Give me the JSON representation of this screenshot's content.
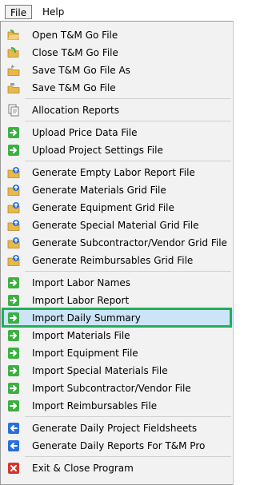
{
  "menubar": {
    "file": "File",
    "help": "Help"
  },
  "menu": {
    "groups": [
      {
        "items": [
          {
            "label": "Open T&M Go File",
            "icon": "folder-open-icon"
          },
          {
            "label": "Close T&M Go File",
            "icon": "folder-close-icon"
          },
          {
            "label": "Save T&M Go File As",
            "icon": "folder-save-as-icon"
          },
          {
            "label": "Save T&M Go File",
            "icon": "folder-save-icon"
          }
        ]
      },
      {
        "items": [
          {
            "label": "Allocation Reports",
            "icon": "document-copy-icon"
          }
        ]
      },
      {
        "items": [
          {
            "label": "Upload Price Data File",
            "icon": "green-arrow-right-icon"
          },
          {
            "label": "Upload Project Settings File",
            "icon": "green-arrow-right-icon"
          }
        ]
      },
      {
        "items": [
          {
            "label": "Generate Empty Labor Report File",
            "icon": "folder-upload-icon"
          },
          {
            "label": "Generate Materials Grid File",
            "icon": "folder-upload-icon"
          },
          {
            "label": "Generate Equipment Grid File",
            "icon": "folder-upload-icon"
          },
          {
            "label": "Generate Special Material Grid File",
            "icon": "folder-upload-icon"
          },
          {
            "label": "Generate Subcontractor/Vendor Grid File",
            "icon": "folder-upload-icon"
          },
          {
            "label": "Generate Reimbursables Grid File",
            "icon": "folder-upload-icon"
          }
        ]
      },
      {
        "items": [
          {
            "label": "Import Labor Names",
            "icon": "green-arrow-right-icon"
          },
          {
            "label": "Import Labor Report",
            "icon": "green-arrow-right-icon"
          },
          {
            "label": "Import Daily Summary",
            "icon": "green-arrow-right-icon",
            "highlighted": true
          },
          {
            "label": "Import Materials File",
            "icon": "green-arrow-right-icon"
          },
          {
            "label": "Import Equipment File",
            "icon": "green-arrow-right-icon"
          },
          {
            "label": "Import Special Materials File",
            "icon": "green-arrow-right-icon"
          },
          {
            "label": "Import Subcontractor/Vendor File",
            "icon": "green-arrow-right-icon"
          },
          {
            "label": "Import Reimbursables File",
            "icon": "green-arrow-right-icon"
          }
        ]
      },
      {
        "items": [
          {
            "label": "Generate Daily Project Fieldsheets",
            "icon": "blue-arrow-left-icon"
          },
          {
            "label": "Generate Daily Reports For T&M Pro",
            "icon": "blue-arrow-left-icon"
          }
        ]
      },
      {
        "items": [
          {
            "label": "Exit & Close Program",
            "icon": "red-close-icon"
          }
        ]
      }
    ]
  },
  "colors": {
    "menu_bg": "#f2f2f2",
    "highlight_bg": "#cce4f7",
    "highlight_frame": "#1fb05a",
    "green_arrow": "#3cb043",
    "blue_arrow": "#2a6fdb",
    "red_close": "#d9342b"
  }
}
